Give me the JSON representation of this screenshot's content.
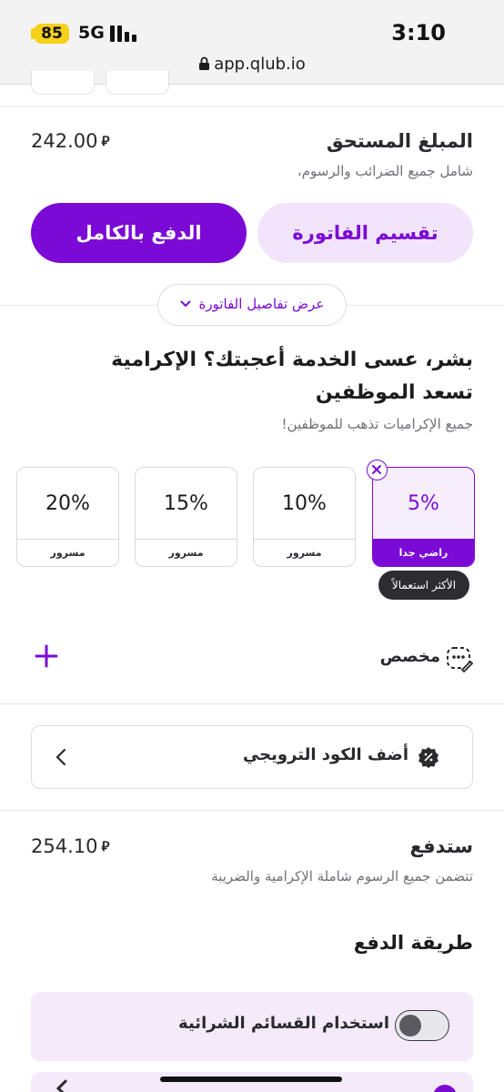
{
  "status_bar": {
    "battery": "85",
    "network": "5G",
    "time": "3:10"
  },
  "browser": {
    "url": "app.qlub.io"
  },
  "bill": {
    "title": "المبلغ المستحق",
    "subtitle": "شامل جميع الضرائب والرسوم،",
    "amount": "242.00",
    "currency_symbol": "⃁",
    "split_button": "تقسيم الفاتورة",
    "pay_full_button": "الدفع بالكامل",
    "details_toggle": "عرض تفاصيل الفاتورة"
  },
  "tip": {
    "title": "بشر، عسى الخدمة أعجبتك؟ الإكرامية تسعد الموظفين",
    "subtitle": "جميع الإكراميات تذهب للموظفين!",
    "options": [
      {
        "percent": "5%",
        "label": "راضي جدا",
        "selected": true
      },
      {
        "percent": "10%",
        "label": "مسرور",
        "selected": false
      },
      {
        "percent": "15%",
        "label": "مسرور",
        "selected": false
      },
      {
        "percent": "20%",
        "label": "مسرور",
        "selected": false
      }
    ],
    "most_used_badge": "الأكثر استعمالاً",
    "custom_label": "مخصص"
  },
  "promo": {
    "label": "أضف الكود الترويجي"
  },
  "total": {
    "title": "ستدفع",
    "subtitle": "تتضمن جميع الرسوم شاملة الإكرامية والضريبة",
    "amount": "254.10",
    "currency_symbol": "⃁"
  },
  "payment": {
    "title": "طريقة الدفع",
    "toggle_label": "استخدام القسائم الشرائية",
    "toggle_on": false
  },
  "colors": {
    "accent": "#7b0ad6",
    "accent_light": "#f1e4fb",
    "tooltip_bg": "#2d2d30"
  }
}
